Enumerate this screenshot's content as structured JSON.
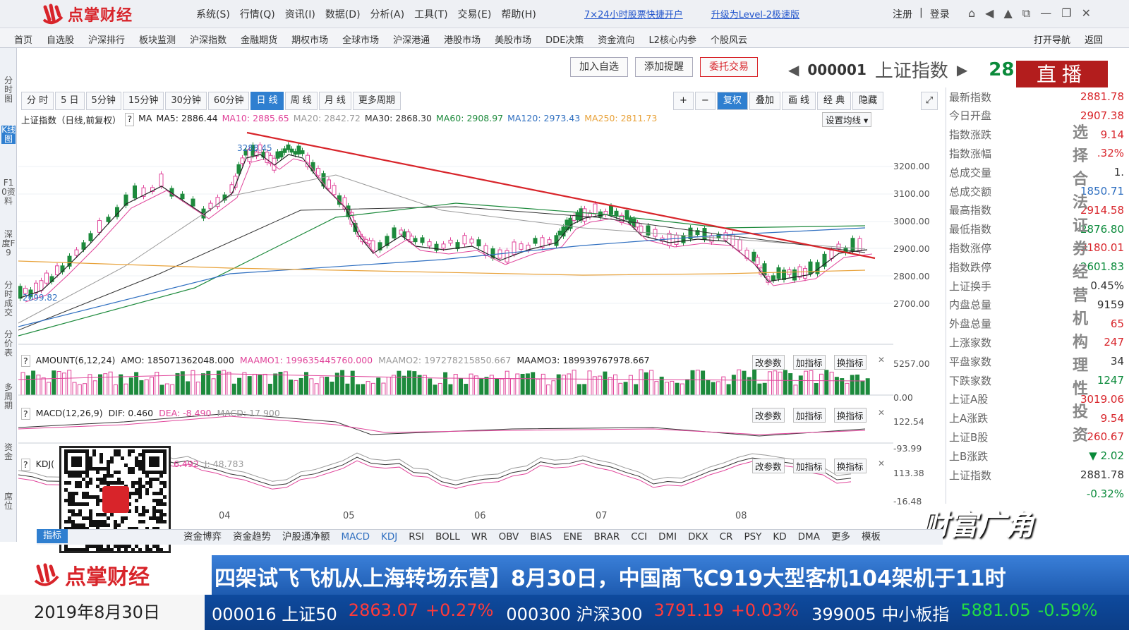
{
  "app": {
    "logo_text": "点掌财经",
    "menus": [
      "系统(S)",
      "行情(Q)",
      "资讯(I)",
      "数据(D)",
      "分析(A)",
      "工具(T)",
      "交易(E)",
      "帮助(H)"
    ],
    "promos": [
      "7×24小时股票快捷开户",
      "升级为Level-2极速版"
    ],
    "login": "注册",
    "register": "登录"
  },
  "nav": {
    "items": [
      "首页",
      "自选股",
      "沪深排行",
      "板块监测",
      "沪深指数",
      "金融期货",
      "期权市场",
      "全球市场",
      "沪深港通",
      "港股市场",
      "美股市场",
      "DDE决策",
      "资金流向",
      "L2核心内参",
      "个股风云"
    ],
    "right": [
      "打开导航",
      "返回"
    ]
  },
  "left_tabs": [
    "分时图",
    "K线图",
    "F10资料",
    "深度F9",
    "分时成交",
    "分价表",
    "多周期",
    "资金",
    "席位"
  ],
  "actions": {
    "add": "加入自选",
    "alert": "添加提醒",
    "trade": "委托交易"
  },
  "code": "000001",
  "name": "上证指数",
  "price_partial": "28",
  "live": "直播",
  "periods": [
    "分 时",
    "5 日",
    "5分钟",
    "15分钟",
    "30分钟",
    "60分钟",
    "日 线",
    "周 线",
    "月 线",
    "更多周期"
  ],
  "right_controls": [
    "+",
    "−",
    "复权",
    "叠加",
    "画 线",
    "经 典",
    "隐藏"
  ],
  "ma_line": {
    "title": "上证指数（日线,前复权）",
    "ma": "MA",
    "ma5": "MA5: 2886.44",
    "ma10": "MA10: 2885.65",
    "ma20": "MA20: 2842.72",
    "ma30": "MA30: 2868.30",
    "ma60": "MA60: 2908.97",
    "ma120": "MA120: 2973.43",
    "ma250": "MA250: 2811.73",
    "set": "设置均线"
  },
  "price_axis": [
    "3200.00",
    "3100.00",
    "3000.00",
    "2900.00",
    "2800.00",
    "2700.00"
  ],
  "high_label": "3288.45",
  "low_label": "2699.82",
  "amount": {
    "title": "AMOUNT(6,12,24)",
    "amo": "AMO: 185071362048.000",
    "m1": "MAAMO1: 199635445760.000",
    "m2": "MAAMO2: 197278215850.667",
    "m3": "MAAMO3: 189939767978.667",
    "axis": [
      "5257.00",
      "0.00"
    ]
  },
  "macd": {
    "title": "MACD(12,26,9)",
    "dif": "DIF: 0.460",
    "dea": "DEA: -8.490",
    "macd": "MACD: 17.900",
    "axis": [
      "122.54",
      "-93.99"
    ]
  },
  "kdj": {
    "title": "KDJ(",
    "j_partial": "6.492",
    "j": "J: 48.783",
    "axis": [
      "113.38",
      "-16.48"
    ]
  },
  "panel_btns": [
    "改参数",
    "加指标",
    "换指标"
  ],
  "months": [
    "04",
    "05",
    "06",
    "07",
    "08"
  ],
  "stats": [
    {
      "k": "最新指数",
      "v": "2881.78",
      "c": "#d8242a"
    },
    {
      "k": "今日开盘",
      "v": "2907.38",
      "c": "#d8242a"
    },
    {
      "k": "指数涨跌",
      "v": "9.14",
      "c": "#d8242a"
    },
    {
      "k": "指数涨幅",
      "v": ".32%",
      "c": "#d8242a"
    },
    {
      "k": "总成交量",
      "v": "1.",
      "c": "#333"
    },
    {
      "k": "总成交额",
      "v": "1850.71",
      "c": "#2f6fc0"
    },
    {
      "k": "最高指数",
      "v": "2914.58",
      "c": "#d8242a"
    },
    {
      "k": "最低指数",
      "v": "2876.80",
      "c": "#0a8a3a"
    },
    {
      "k": "指数涨停",
      "v": "3180.01",
      "c": "#d8242a"
    },
    {
      "k": "指数跌停",
      "v": "2601.83",
      "c": "#0a8a3a"
    },
    {
      "k": "上证换手",
      "v": "0.45%",
      "c": "#333"
    },
    {
      "k": "内盘总量",
      "v": "9159",
      "c": "#333"
    },
    {
      "k": "外盘总量",
      "v": "65",
      "c": "#d8242a"
    },
    {
      "k": "上涨家数",
      "v": "247",
      "c": "#d8242a"
    },
    {
      "k": "平盘家数",
      "v": "34",
      "c": "#333"
    },
    {
      "k": "下跌家数",
      "v": "1247",
      "c": "#0a8a3a"
    },
    {
      "k": "上证A股",
      "v": "3019.06",
      "c": "#d8242a"
    },
    {
      "k": "上A涨跌",
      "v": "9.54",
      "c": "#d8242a"
    },
    {
      "k": "上证B股",
      "v": "260.67",
      "c": "#d8242a"
    },
    {
      "k": "上B涨跌",
      "v": "▼ 2.02",
      "c": "#0a8a3a"
    },
    {
      "k": "上证指数",
      "v": "2881.78",
      "c": "#333"
    },
    {
      "k": "",
      "v": "-0.32%",
      "c": "#0a8a3a"
    }
  ],
  "overlay_chars": [
    "选",
    "择",
    "合",
    "法",
    "证",
    "券",
    "经",
    "营",
    "机",
    "构",
    "理",
    "性",
    "投",
    "资"
  ],
  "indicator_tab": "指标",
  "indicators": [
    "资金博弈",
    "资金趋势",
    "沪股通净额",
    "MACD",
    "KDJ",
    "RSI",
    "BOLL",
    "WR",
    "OBV",
    "BIAS",
    "ENE",
    "BRAR",
    "CCI",
    "DMI",
    "DKX",
    "CR",
    "PSY",
    "KD",
    "DMA",
    "更多",
    "模板"
  ],
  "watermark": "财富广角",
  "news": {
    "logo": "点掌财经",
    "text": "四架试飞飞机从上海转场东营】8月30日，中国商飞C919大型客机104架机于11时"
  },
  "ticker": {
    "date": "2019年8月30日",
    "items": [
      {
        "name": "000016 上证50",
        "price": "2863.07",
        "chg": "+0.27%",
        "c": "red"
      },
      {
        "name": "000300 沪深300",
        "price": "3791.19",
        "chg": "+0.03%",
        "c": "red"
      },
      {
        "name": "399005 中小板指",
        "price": "5881.05",
        "chg": "-0.59%",
        "c": "green"
      }
    ]
  }
}
